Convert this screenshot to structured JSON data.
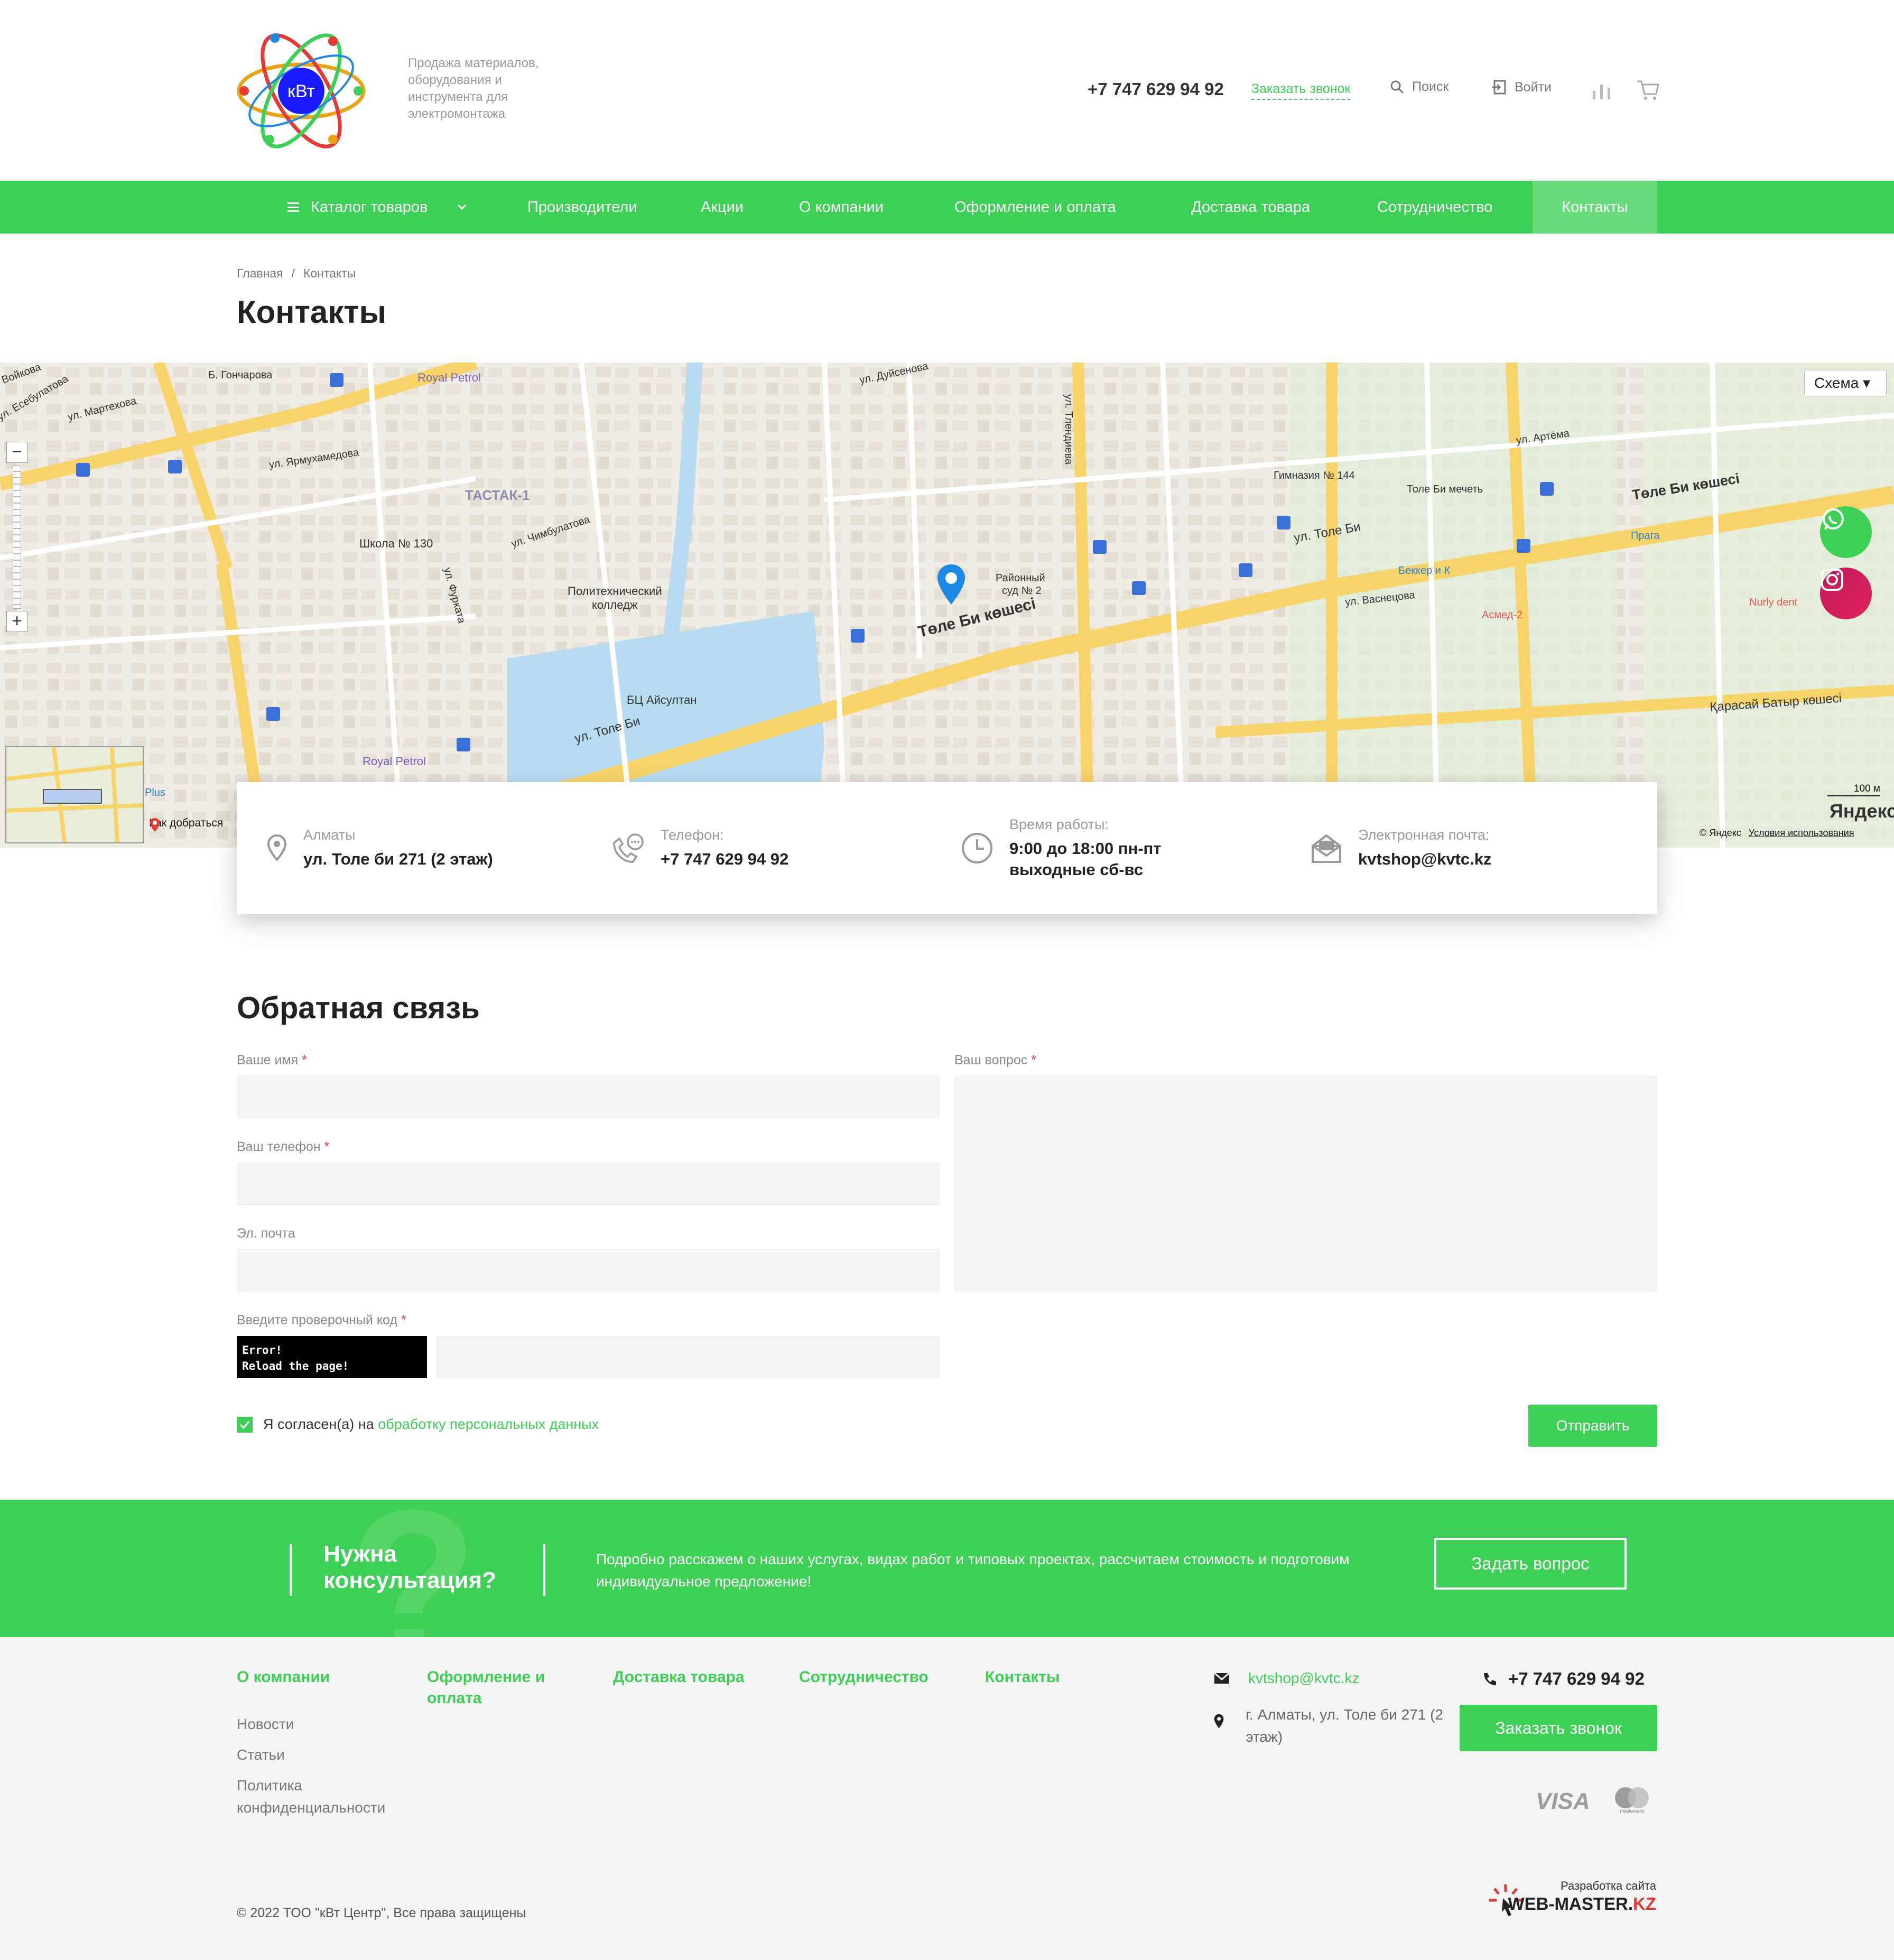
{
  "header": {
    "tagline": [
      "Продажа материалов,",
      "оборудования и",
      "инструмента для",
      "электромонтажа"
    ],
    "logo_text": "кВт",
    "phone": "+7 747 629 94 92",
    "callback": "Заказать звонок",
    "search": "Поиск",
    "login": "Войти"
  },
  "nav": {
    "catalog": "Каталог товаров",
    "items": [
      "Производители",
      "Акции",
      "О компании",
      "Оформление и оплата",
      "Доставка товара",
      "Сотрудничество",
      "Контакты"
    ]
  },
  "breadcrumb": [
    "Главная",
    "Контакты"
  ],
  "page_title": "Контакты",
  "map": {
    "scheme": "Схема",
    "route": "Как добраться",
    "scale": "100 м",
    "brand": "Яндекс",
    "copyright": "© Яндекс",
    "terms": "Условия использования",
    "labels": {
      "tole_bi_main": "Төле Би көшесі",
      "tole_bi_2": "ул. Толе Би",
      "tole_bi_3": "ул. Толе Би",
      "tole_bi_4": "Төле Би көшесі",
      "karasay": "Қарасай Батыр көшесі",
      "royal1": "Royal Petrol",
      "royal2": "Royal Petrol",
      "tastak": "ТАСТАК-1",
      "school": "Школа № 130",
      "college1": "Политехнический",
      "college2": "колледж",
      "bc": "БЦ Айсултан",
      "court1": "Районный",
      "court2": "суд № 2",
      "gym": "Гимназия № 144",
      "mosque": "Толе Би мечеть",
      "bekker": "Беккер и К",
      "asmed": "Асмед-2",
      "praga": "Прага",
      "nurly": "Nurly dent",
      "martexova": "ул. Мартехова",
      "yarmuh": "ул. Ярмухамедова",
      "chimbulat": "ул. Чимбулатова",
      "duysenova": "ул. Дуйсенова",
      "artema": "ул. Артёма",
      "vasnecova": "ул. Васнецова",
      "furmanova": "ул. Фурката",
      "esebulatova": "ул. Есебулатова",
      "voykova": "Войкова",
      "goncharova": "Б. Гончарова",
      "plus": "Plus",
      "tlendieva": "ул. Тлендиева"
    }
  },
  "contacts": {
    "city": "Алматы",
    "address": "ул. Толе би 271 (2 этаж)",
    "phone_label": "Телефон:",
    "phone": "+7 747 629 94 92",
    "hours_label": "Время работы:",
    "hours_1": "9:00 до 18:00 пн-пт",
    "hours_2": "выходные сб-вс",
    "email_label": "Электронная почта:",
    "email": "kvtshop@kvtc.kz"
  },
  "feedback": {
    "title": "Обратная связь",
    "name_label": "Ваше имя",
    "phone_label": "Ваш телефон",
    "email_label": "Эл. почта",
    "question_label": "Ваш вопрос",
    "captcha_label": "Введите проверочный код",
    "captcha_err1": "Error!",
    "captcha_err2": "Reload the page!",
    "agree_text": "Я согласен(а) на",
    "agree_link": "обработку персональных данных",
    "submit": "Отправить",
    "required_mark": "*"
  },
  "consult": {
    "title": "Нужна консультация?",
    "text": "Подробно расскажем о наших услугах, видах работ и типовых проектах, рассчитаем стоимость и подготовим индивидуальное предложение!",
    "button": "Задать вопрос",
    "bg_glyph": "?"
  },
  "footer": {
    "col1_title": "О компании",
    "col1_links": [
      "Новости",
      "Статьи",
      "Политика конфиденциальности"
    ],
    "col2_title": "Оформление и оплата",
    "col3_title": "Доставка товара",
    "col4_title": "Сотрудничество",
    "col5_title": "Контакты",
    "email": "kvtshop@kvtc.kz",
    "address": "г. Алматы, ул. Толе би 271 (2 этаж)",
    "phone": "+7 747 629 94 92",
    "callback": "Заказать звонок",
    "visa": "VISA",
    "mastercard": "mastercard",
    "copyright": "© 2022 ТОО \"кВт Центр\", Все права защищены",
    "dev_label": "Разработка сайта",
    "dev_name_1": "WEB-MASTER.",
    "dev_name_2": "KZ"
  },
  "colors": {
    "accent": "#3ecf56",
    "accent_light": "#68dc7b",
    "required": "#e53935",
    "instagram": "#e0245e"
  }
}
